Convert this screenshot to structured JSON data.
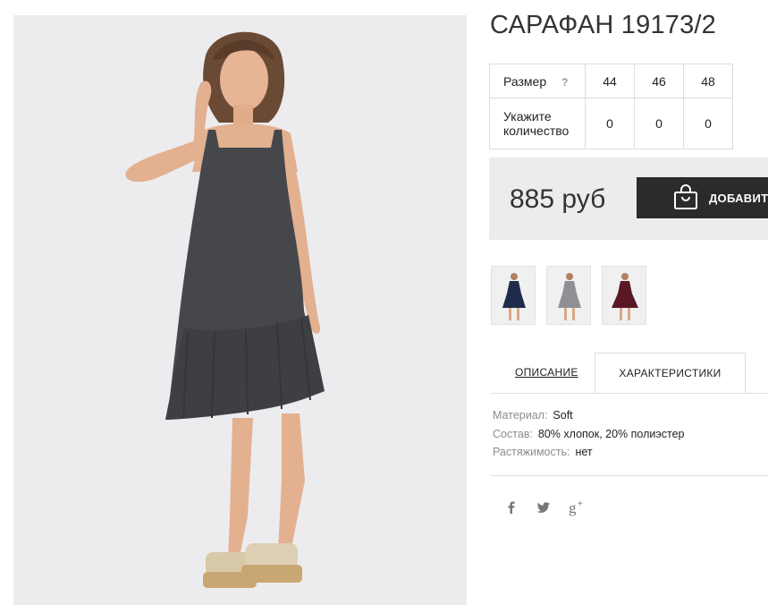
{
  "product": {
    "title": "САРАФАН 19173/2",
    "price": "885 руб",
    "add_to_cart_label": "ДОБАВИТЬ",
    "image_alt": "dress-photo"
  },
  "sizes": {
    "size_label": "Размер",
    "help_label": "?",
    "quantity_label_line1": "Укажите",
    "quantity_label_line2": "количество",
    "items": [
      {
        "size": "44",
        "qty": "0"
      },
      {
        "size": "46",
        "qty": "0"
      },
      {
        "size": "48",
        "qty": "0"
      }
    ]
  },
  "thumbnails": [
    {
      "color_name": "navy",
      "color": "#1f2b4a"
    },
    {
      "color_name": "grey",
      "color": "#8e9096"
    },
    {
      "color_name": "burgundy",
      "color": "#5a1726"
    }
  ],
  "tabs": {
    "description": "ОПИСАНИЕ",
    "characteristics": "ХАРАКТЕРИСТИКИ",
    "active": "characteristics"
  },
  "specs": [
    {
      "key": "Материал:",
      "value": "Soft"
    },
    {
      "key": "Состав:",
      "value": "80% хлопок, 20% полиэстер"
    },
    {
      "key": "Растяжимость:",
      "value": "нет"
    }
  ],
  "social": [
    {
      "name": "facebook-icon",
      "glyph": "f"
    },
    {
      "name": "twitter-icon",
      "glyph": "t"
    },
    {
      "name": "google-plus-icon",
      "glyph": "g+"
    }
  ],
  "colors": {
    "button_bg": "#2b2b2b",
    "price_box_bg": "#ececec",
    "photo_bg": "#ececee",
    "dress": "#45474b"
  }
}
